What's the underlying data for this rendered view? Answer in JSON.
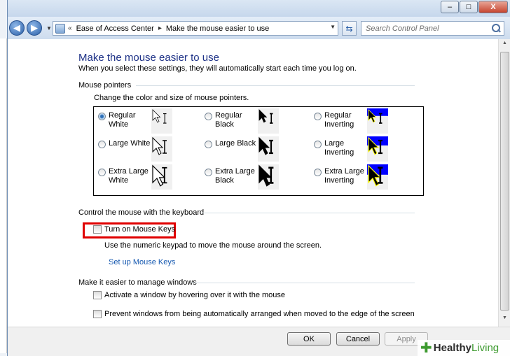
{
  "window": {
    "controls": {
      "minimize": "–",
      "maximize": "□",
      "close": "X"
    }
  },
  "nav": {
    "back_icon": "back-arrow-icon",
    "forward_icon": "forward-arrow-icon",
    "breadcrumb": [
      "Ease of Access Center",
      "Make the mouse easier to use"
    ],
    "search_placeholder": "Search Control Panel"
  },
  "page": {
    "title": "Make the mouse easier to use",
    "description": "When you select these settings, they will automatically start each time you log on."
  },
  "mouse_pointers": {
    "section_title": "Mouse pointers",
    "description": "Change the color and size of mouse pointers.",
    "options": [
      {
        "label_line1": "Regular",
        "label_line2": "White",
        "checked": true,
        "style": "white",
        "size": "regular"
      },
      {
        "label_line1": "Regular Black",
        "label_line2": "",
        "checked": false,
        "style": "black",
        "size": "regular"
      },
      {
        "label_line1": "Regular",
        "label_line2": "Inverting",
        "checked": false,
        "style": "inverting",
        "size": "regular"
      },
      {
        "label_line1": "Large White",
        "label_line2": "",
        "checked": false,
        "style": "white",
        "size": "large"
      },
      {
        "label_line1": "Large Black",
        "label_line2": "",
        "checked": false,
        "style": "black",
        "size": "large"
      },
      {
        "label_line1": "Large",
        "label_line2": "Inverting",
        "checked": false,
        "style": "inverting",
        "size": "large"
      },
      {
        "label_line1": "Extra Large",
        "label_line2": "White",
        "checked": false,
        "style": "white",
        "size": "extra-large"
      },
      {
        "label_line1": "Extra Large",
        "label_line2": "Black",
        "checked": false,
        "style": "black",
        "size": "extra-large"
      },
      {
        "label_line1": "Extra Large",
        "label_line2": "Inverting",
        "checked": false,
        "style": "inverting",
        "size": "extra-large"
      }
    ]
  },
  "keyboard": {
    "section_title": "Control the mouse with the keyboard",
    "mouse_keys_label": "Turn on Mouse Keys",
    "mouse_keys_checked": false,
    "mouse_keys_desc": "Use the numeric keypad to move the mouse around the screen.",
    "setup_link": "Set up Mouse Keys"
  },
  "windows": {
    "section_title": "Make it easier to manage windows",
    "hover_label": "Activate a window by hovering over it with the mouse",
    "hover_checked": false,
    "prevent_label": "Prevent windows from being automatically arranged when moved to the edge of the screen",
    "prevent_checked": false
  },
  "buttons": {
    "ok": "OK",
    "cancel": "Cancel",
    "apply": "Apply"
  },
  "watermark": {
    "part1": "Healthy",
    "part2": "Living"
  },
  "colors": {
    "title_blue": "#1e3287",
    "link_blue": "#1558b0",
    "highlight_red": "#e00000",
    "inverting_blue": "#0000ff"
  }
}
